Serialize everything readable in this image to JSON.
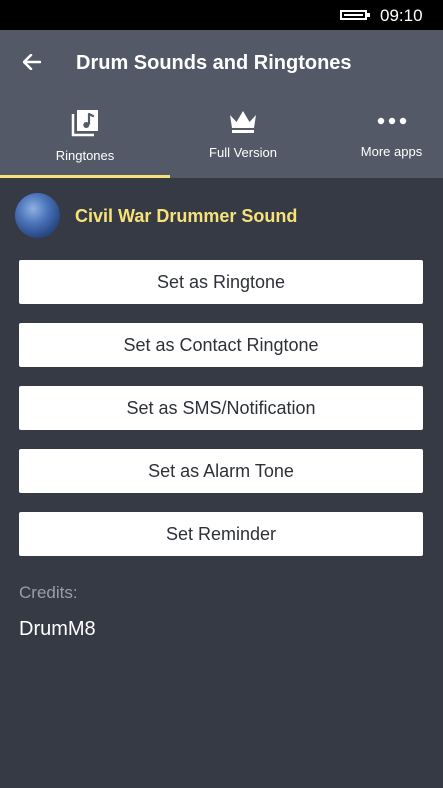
{
  "status_bar": {
    "time": "09:10",
    "battery_icon": "battery-icon"
  },
  "header": {
    "back_icon": "arrow-left-icon",
    "title": "Drum Sounds and Ringtones"
  },
  "tabs": [
    {
      "label": "Ringtones",
      "icon": "music-library-icon",
      "selected": true
    },
    {
      "label": "Full Version",
      "icon": "crown-icon",
      "selected": false
    },
    {
      "label": "More apps",
      "icon": "more-dots-icon",
      "selected": false
    }
  ],
  "sound": {
    "title": "Civil War Drummer Sound"
  },
  "actions": [
    {
      "label": "Set as Ringtone"
    },
    {
      "label": "Set as Contact Ringtone"
    },
    {
      "label": "Set as SMS/Notification"
    },
    {
      "label": "Set as Alarm Tone"
    },
    {
      "label": "Set Reminder"
    }
  ],
  "credits": {
    "label": "Credits:",
    "value": "DrumM8"
  },
  "colors": {
    "background": "#363a44",
    "header": "#535966",
    "accent": "#f7e27a",
    "status_bar": "#000000"
  }
}
